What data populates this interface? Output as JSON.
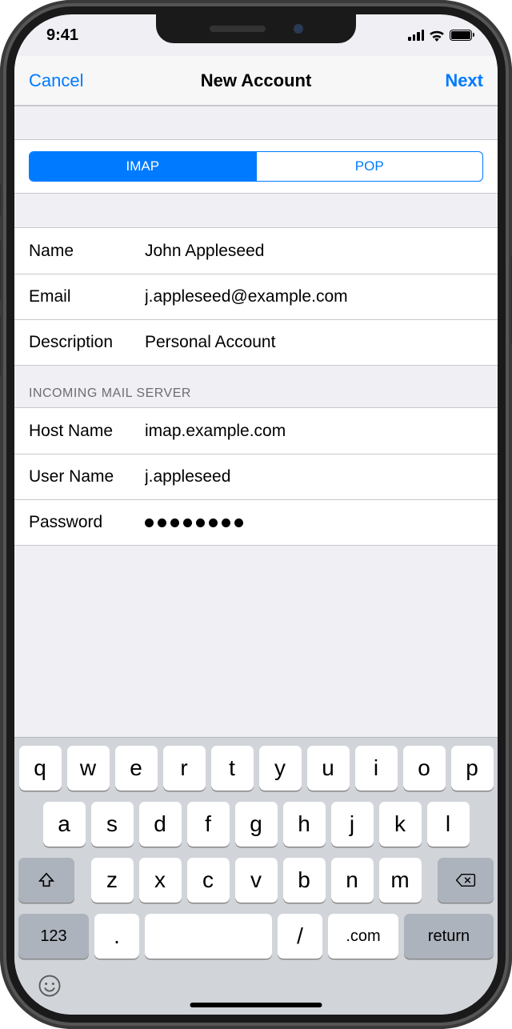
{
  "status": {
    "time": "9:41"
  },
  "nav": {
    "cancel": "Cancel",
    "title": "New Account",
    "next": "Next"
  },
  "seg": {
    "imap": "IMAP",
    "pop": "POP"
  },
  "account": {
    "name_label": "Name",
    "name_value": "John Appleseed",
    "email_label": "Email",
    "email_value": "j.appleseed@example.com",
    "desc_label": "Description",
    "desc_value": "Personal Account"
  },
  "incoming": {
    "header": "INCOMING MAIL SERVER",
    "host_label": "Host Name",
    "host_value": "imap.example.com",
    "user_label": "User Name",
    "user_value": "j.appleseed",
    "pass_label": "Password",
    "pass_masked_count": 8
  },
  "keyboard": {
    "row1": [
      "q",
      "w",
      "e",
      "r",
      "t",
      "y",
      "u",
      "i",
      "o",
      "p"
    ],
    "row2": [
      "a",
      "s",
      "d",
      "f",
      "g",
      "h",
      "j",
      "k",
      "l"
    ],
    "row3": [
      "z",
      "x",
      "c",
      "v",
      "b",
      "n",
      "m"
    ],
    "key_123": "123",
    "key_dot": ".",
    "key_slash": "/",
    "key_com": ".com",
    "key_return": "return"
  }
}
